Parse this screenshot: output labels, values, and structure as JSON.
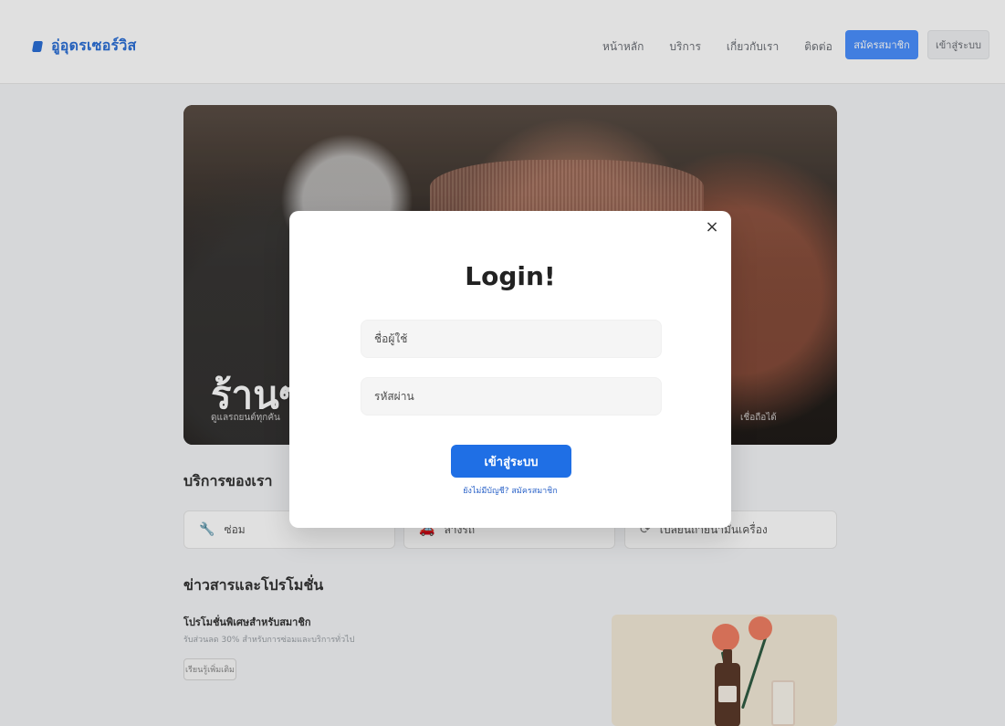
{
  "nav": {
    "brand": "อู่อุดรเซอร์วิส",
    "menu": [
      "หน้าหลัก",
      "บริการ",
      "เกี่ยวกับเรา",
      "ติดต่อ"
    ],
    "signup_button": "สมัครสมาชิก",
    "login_button": "เข้าสู่ระบบ"
  },
  "hero": {
    "title": "ร้านซ่อ",
    "subtitle": "ดูแลรถยนต์ทุกคัน",
    "subtitle_right": "เชื่อถือได้"
  },
  "services": {
    "title": "บริการของเรา",
    "items": [
      {
        "label": "ซ่อม",
        "icon": "wrench-icon"
      },
      {
        "label": "ล้างรถ",
        "icon": "car-wash-icon"
      },
      {
        "label": "เปลี่ยนถ่ายน้ำมันเครื่อง",
        "icon": "oil-change-icon"
      }
    ]
  },
  "news": {
    "title": "ข่าวสารและโปรโมชั่น",
    "promo_title": "โปรโมชั่นพิเศษสำหรับสมาชิก",
    "promo_desc": "รับส่วนลด 30% สำหรับการซ่อมและบริการทั่วไป",
    "promo_button": "เรียนรู้เพิ่มเติม"
  },
  "modal": {
    "title": "Login!",
    "username_placeholder": "ชื่อผู้ใช้",
    "password_placeholder": "รหัสผ่าน",
    "submit": "เข้าสู่ระบบ",
    "signup_link": "ยังไม่มีบัญชี? สมัครสมาชิก",
    "close_icon": "close-icon"
  },
  "colors": {
    "primary": "#1f6fe5",
    "nav_signup": "#4a90ff",
    "overlay": "rgba(0,0,0,0.12)"
  }
}
